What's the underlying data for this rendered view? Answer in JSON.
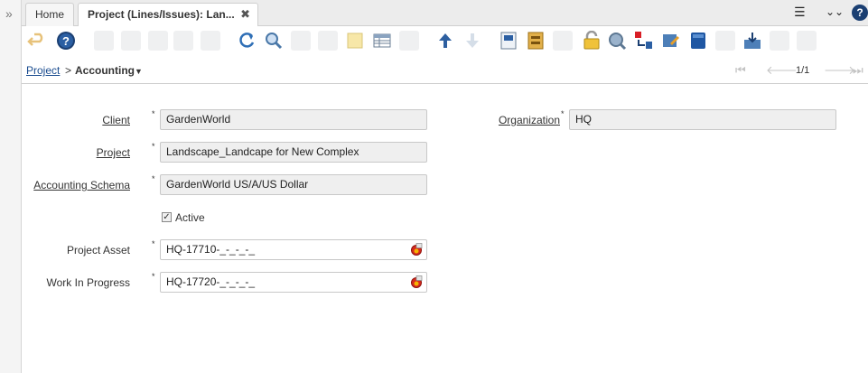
{
  "tabs": {
    "home_label": "Home",
    "active_label": "Project (Lines/Issues): Lan..."
  },
  "breadcrumb": {
    "parent": "Project",
    "separator": ">",
    "current": "Accounting"
  },
  "pager": {
    "record_position": "1/1"
  },
  "form": {
    "client": {
      "label": "Client",
      "value": "GardenWorld"
    },
    "organization": {
      "label": "Organization",
      "value": "HQ"
    },
    "project": {
      "label": "Project",
      "value": "Landscape_Landcape for New Complex"
    },
    "accounting_schema": {
      "label": "Accounting Schema",
      "value": "GardenWorld US/A/US Dollar"
    },
    "active": {
      "label": "Active",
      "checked": true
    },
    "project_asset": {
      "label": "Project Asset",
      "value": "HQ-17710-_-_-_-_"
    },
    "work_in_progress": {
      "label": "Work In Progress",
      "value": "HQ-17720-_-_-_-_"
    },
    "required_marker": "*"
  },
  "colors": {
    "link": "#1a4c8f",
    "field_readonly_bg": "#efefef",
    "help_icon_bg": "#1b3f72"
  }
}
